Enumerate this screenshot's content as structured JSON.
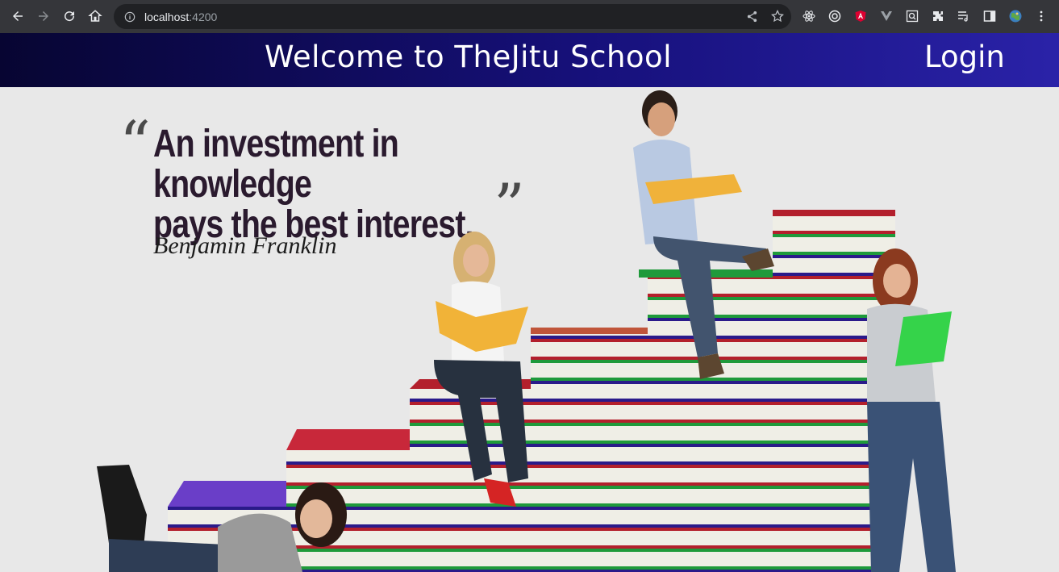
{
  "browser": {
    "url_host": "localhost",
    "url_port": ":4200",
    "icons": [
      "back-icon",
      "forward-icon",
      "reload-icon",
      "home-icon",
      "info-icon",
      "share-icon",
      "bookmark-star-icon",
      "react-devtools-icon",
      "extension-circle-icon",
      "angular-devtools-icon",
      "vue-devtools-icon",
      "extension-search-icon",
      "extensions-puzzle-icon",
      "reading-list-icon",
      "side-panel-icon",
      "profile-avatar-icon",
      "menu-kebab-icon"
    ]
  },
  "header": {
    "title": "Welcome to TheJitu School",
    "login_label": "Login"
  },
  "hero": {
    "quote_line1": "An investment in knowledge",
    "quote_line2": "pays the best interest.",
    "open_quote": "“",
    "close_quote": "”",
    "author": "Benjamin Franklin"
  },
  "colors": {
    "header_start": "#070532",
    "header_end": "#2a22a8",
    "hero_bg": "#e8e8e8",
    "quote_text": "#2a1a2e"
  }
}
